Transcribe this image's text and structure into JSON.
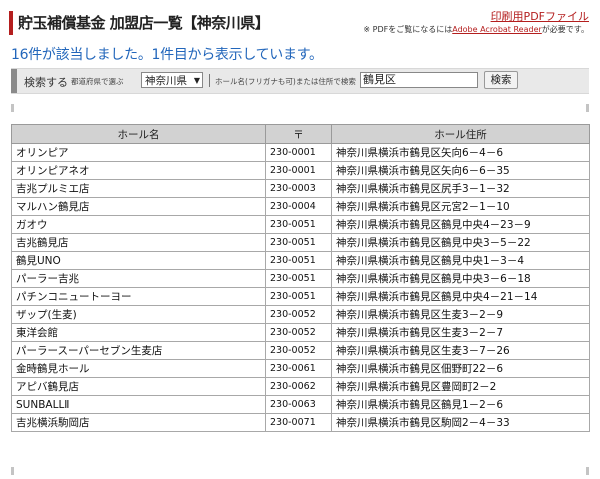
{
  "header": {
    "title": "貯玉補償基金 加盟店一覧【神奈川県】",
    "pdf_link": "印刷用PDFファイル",
    "pdf_note_prefix": "※ PDFをご覧になるには",
    "pdf_note_link": "Adobe Acrobat Reader",
    "pdf_note_suffix": "が必要です。"
  },
  "result_count": "16件が該当しました。1件目から表示しています。",
  "search": {
    "label": "検索する",
    "prefecture_label": "都道府県で選ぶ",
    "prefecture_value": "神奈川県",
    "name_label": "ホール名(フリガナも可)または住所で検索",
    "query_value": "鶴見区",
    "button_label": "検索"
  },
  "table": {
    "headers": [
      "ホール名",
      "〒",
      "ホール住所"
    ],
    "rows": [
      [
        "オリンピア",
        "230-0001",
        "神奈川県横浜市鶴見区矢向6－4－6"
      ],
      [
        "オリンピアネオ",
        "230-0001",
        "神奈川県横浜市鶴見区矢向6－6－35"
      ],
      [
        "吉兆プルミエ店",
        "230-0003",
        "神奈川県横浜市鶴見区尻手3－1－32"
      ],
      [
        "マルハン鶴見店",
        "230-0004",
        "神奈川県横浜市鶴見区元宮2－1－10"
      ],
      [
        "ガオウ",
        "230-0051",
        "神奈川県横浜市鶴見区鶴見中央4－23－9"
      ],
      [
        "吉兆鶴見店",
        "230-0051",
        "神奈川県横浜市鶴見区鶴見中央3－5－22"
      ],
      [
        "鶴見UNO",
        "230-0051",
        "神奈川県横浜市鶴見区鶴見中央1－3－4"
      ],
      [
        "パーラー吉兆",
        "230-0051",
        "神奈川県横浜市鶴見区鶴見中央3－6－18"
      ],
      [
        "パチンコニュートーヨー",
        "230-0051",
        "神奈川県横浜市鶴見区鶴見中央4－21－14"
      ],
      [
        "ザップ(生麦)",
        "230-0052",
        "神奈川県横浜市鶴見区生麦3－2－9"
      ],
      [
        "東洋会館",
        "230-0052",
        "神奈川県横浜市鶴見区生麦3－2－7"
      ],
      [
        "パーラースーパーセブン生麦店",
        "230-0052",
        "神奈川県横浜市鶴見区生麦3－7－26"
      ],
      [
        "金時鶴見ホール",
        "230-0061",
        "神奈川県横浜市鶴見区佃野町22－6"
      ],
      [
        "アピバ鶴見店",
        "230-0062",
        "神奈川県横浜市鶴見区豊岡町2－2"
      ],
      [
        "SUNBALLⅡ",
        "230-0063",
        "神奈川県横浜市鶴見区鶴見1－2－6"
      ],
      [
        "吉兆横浜駒岡店",
        "230-0071",
        "神奈川県横浜市鶴見区駒岡2－4－33"
      ]
    ]
  }
}
